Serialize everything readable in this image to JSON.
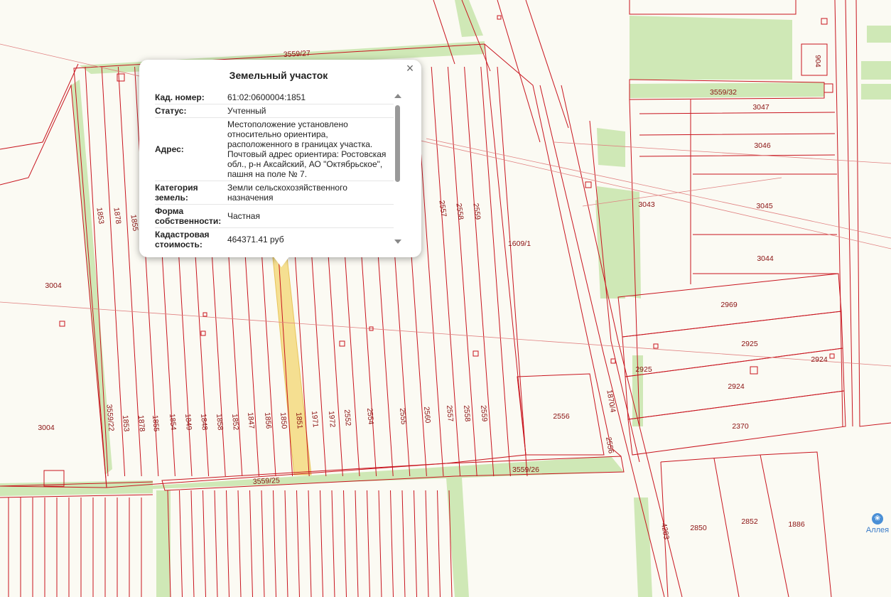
{
  "popup": {
    "title": "Земельный участок",
    "close": "×",
    "rows": [
      {
        "key": "Кад. номер:",
        "value": "61:02:0600004:1851"
      },
      {
        "key": "Статус:",
        "value": "Учтенный"
      },
      {
        "key": "Адрес:",
        "value": "Местоположение установлено относительно ориентира, расположенного в границах участка. Почтовый адрес ориентира: Ростовская обл., р-н Аксайский, АО \"Октябрьское\", пашня на поле № 7."
      },
      {
        "key": "Категория земель:",
        "value": "Земли сельскохозяйственного назначения"
      },
      {
        "key": "Форма собственности:",
        "value": "Частная"
      },
      {
        "key": "Кадастровая стоимость:",
        "value": "464371.41 руб"
      }
    ]
  },
  "poi": {
    "label": "Аллея",
    "icon": "tree-pin-icon"
  },
  "colors": {
    "boundary": "#c8141e",
    "green": "#cfe8b6",
    "highlight": "#f5df91",
    "label": "#8a1010",
    "background": "#fbfaf3"
  },
  "parcels": {
    "upper_row": [
      "1853",
      "1878",
      "1855",
      "2557",
      "2558",
      "2559"
    ],
    "lower_row": [
      "3559/22",
      "1853",
      "1878",
      "1855",
      "1854",
      "1849",
      "1848",
      "1858",
      "1852",
      "1847",
      "1856",
      "1850",
      "1851",
      "1971",
      "1972",
      "2552",
      "2554",
      "2555",
      "2560",
      "2557",
      "2558",
      "2559"
    ],
    "roads": [
      "3559/27",
      "3559/25",
      "3559/26",
      "3559/32"
    ],
    "others": [
      "3004",
      "3004",
      "1609/1",
      "2556",
      "2556",
      "1870/4",
      "3043",
      "3045",
      "3044",
      "3046",
      "3047",
      "904",
      "2969",
      "2925",
      "2925",
      "2924",
      "2924",
      "2370",
      "2850",
      "2852",
      "1886",
      "4283"
    ]
  }
}
